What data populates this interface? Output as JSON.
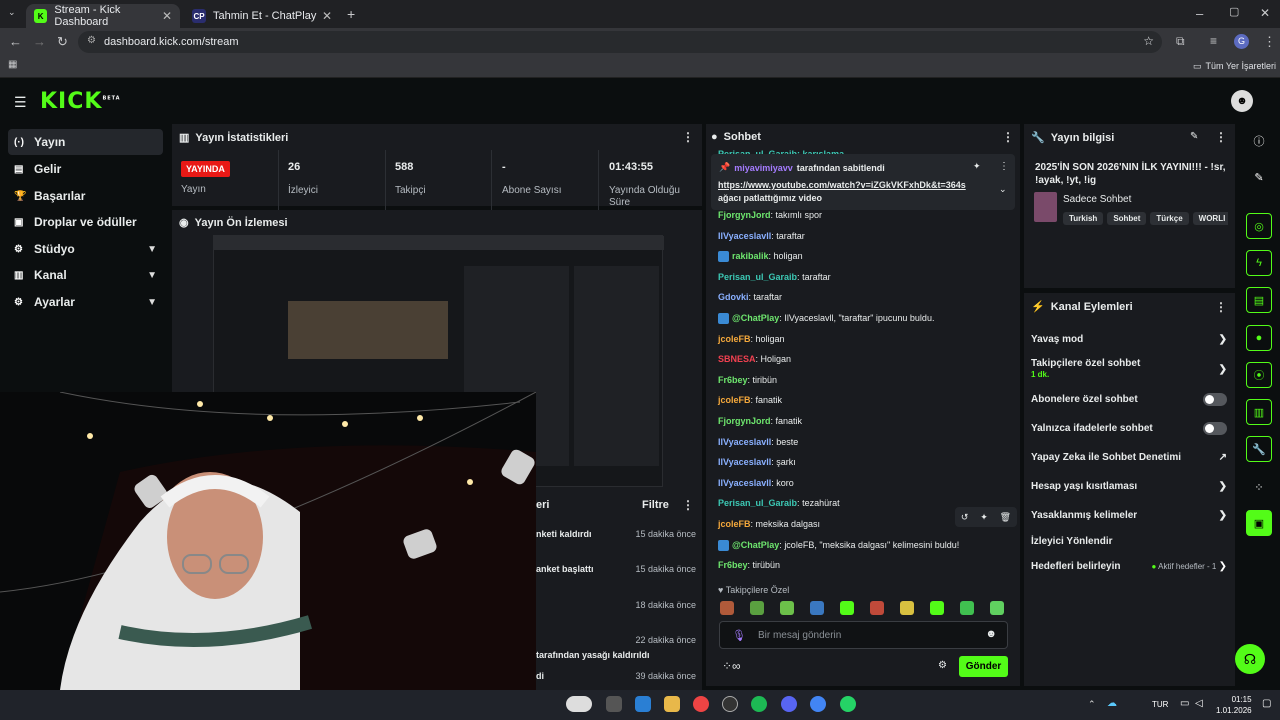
{
  "browser": {
    "tabs": [
      {
        "title": "Stream - Kick Dashboard",
        "icon": "K"
      },
      {
        "title": "Tahmin Et - ChatPlay",
        "icon": "CP"
      }
    ],
    "url": "dashboard.kick.com/stream",
    "bookmarks_label": "Tüm Yer İşaretleri"
  },
  "kick": {
    "logo": "KICK",
    "logo_sup": "BETA",
    "nav": [
      {
        "label": "Yayın",
        "icon": "(·)"
      },
      {
        "label": "Gelir",
        "icon": "▤"
      },
      {
        "label": "Başarılar",
        "icon": "🏆"
      },
      {
        "label": "Droplar ve ödüller",
        "icon": "▣"
      },
      {
        "label": "Stüdyo",
        "icon": "⚙"
      },
      {
        "label": "Kanal",
        "icon": "▥"
      },
      {
        "label": "Ayarlar",
        "icon": "⚙"
      }
    ],
    "stats": {
      "title": "Yayın İstatistikleri",
      "live_badge": "YAYINDA",
      "items": [
        {
          "value": "",
          "label": "Yayın"
        },
        {
          "value": "26",
          "label": "İzleyici"
        },
        {
          "value": "588",
          "label": "Takipçi"
        },
        {
          "value": "-",
          "label": "Abone Sayısı"
        },
        {
          "value": "01:43:55",
          "label": "Yayında Olduğu Süre"
        }
      ]
    },
    "preview": {
      "title": "Yayın Ön İzlemesi"
    },
    "recent": {
      "title_fragment": "eri",
      "filter": "Filtre",
      "rows": [
        {
          "text": "nketi kaldırdı",
          "time": "15 dakika önce"
        },
        {
          "text": "anket başlattı",
          "time": "15 dakika önce"
        },
        {
          "text": "",
          "time": "18 dakika önce"
        },
        {
          "text": "",
          "time": "22 dakika önce"
        },
        {
          "text": "tarafından yasağı kaldırıldı",
          "time": ""
        },
        {
          "text": "di",
          "time": "39 dakika önce"
        }
      ]
    },
    "chat": {
      "title": "Sohbet",
      "top_partial": "Perisan_ul_Garaib: karışlama",
      "pinned_by": "miyavimiyavv",
      "pinned_suffix": "tarafından sabitlendi",
      "pinned_link": "https://www.youtube.com/watch?v=iZGkVKFxhDk&t=364s",
      "pinned_text": "ağacı patlattığımız video",
      "messages": [
        {
          "user": "FjorgynJord",
          "text": "takımlı spor",
          "color": "green",
          "badge": false
        },
        {
          "user": "IlVyaceslavll",
          "text": "taraftar",
          "color": "blue",
          "badge": false
        },
        {
          "user": "rakibalik",
          "text": "holigan",
          "color": "green",
          "badge": true
        },
        {
          "user": "Perisan_ul_Garaib",
          "text": "taraftar",
          "color": "teal",
          "badge": false
        },
        {
          "user": "Gdovki",
          "text": "taraftar",
          "color": "blue",
          "badge": false
        },
        {
          "user": "@ChatPlay",
          "text": "IlVyaceslavll, \"taraftar\" ipucunu buldu.",
          "color": "green",
          "badge": true
        },
        {
          "user": "jcoleFB",
          "text": "holigan",
          "color": "orange",
          "badge": false
        },
        {
          "user": "SBNESA",
          "text": "Holigan",
          "color": "red",
          "badge": false
        },
        {
          "user": "Fr6bey",
          "text": "tiribün",
          "color": "green",
          "badge": false
        },
        {
          "user": "jcoleFB",
          "text": "fanatik",
          "color": "orange",
          "badge": false
        },
        {
          "user": "FjorgynJord",
          "text": "fanatik",
          "color": "green",
          "badge": false
        },
        {
          "user": "IlVyaceslavll",
          "text": "beste",
          "color": "blue",
          "badge": false
        },
        {
          "user": "IlVyaceslavll",
          "text": "şarkı",
          "color": "blue",
          "badge": false
        },
        {
          "user": "IlVyaceslavll",
          "text": "koro",
          "color": "blue",
          "badge": false
        },
        {
          "user": "Perisan_ul_Garaib",
          "text": "tezahürat",
          "color": "teal",
          "badge": false
        },
        {
          "user": "jcoleFB",
          "text": "meksika dalgası",
          "color": "orange",
          "badge": false
        },
        {
          "user": "@ChatPlay",
          "text": "jcoleFB, \"meksika dalgası\" kelimesini buldu!",
          "color": "green",
          "badge": true
        },
        {
          "user": "Fr6bey",
          "text": "tirübün",
          "color": "green",
          "badge": false
        }
      ],
      "followers_only": "Takipçilere Özel",
      "placeholder": "Bir mesaj gönderin",
      "send": "Gönder"
    },
    "stream_info": {
      "title": "Yayın bilgisi",
      "stream_title": "2025'İN SON 2026'NIN İLK YAYINI!!! - !sr, !ayak, !yt, !ig",
      "category": "Sadece Sohbet",
      "tags": [
        "Turkish",
        "Sohbet",
        "Türkçe",
        "WORLI"
      ]
    },
    "actions": {
      "title": "Kanal Eylemleri",
      "rows": [
        {
          "label": "Yavaş mod",
          "control": "chevron"
        },
        {
          "label": "Takipçilere özel sohbet",
          "sub": "1 dk.",
          "control": "chevron"
        },
        {
          "label": "Abonelere özel sohbet",
          "control": "toggle"
        },
        {
          "label": "Yalnızca ifadelerle sohbet",
          "control": "toggle"
        },
        {
          "label": "Yapay Zeka ile Sohbet Denetimi",
          "control": "external"
        },
        {
          "label": "Hesap yaşı kısıtlaması",
          "control": "chevron"
        },
        {
          "label": "Yasaklanmış kelimeler",
          "control": "chevron"
        },
        {
          "label": "İzleyici Yönlendir",
          "control": "none"
        },
        {
          "label": "Hedefleri belirleyin",
          "control": "chevron",
          "extra": "Aktif hedefler - 1"
        }
      ]
    }
  },
  "taskbar": {
    "lang": "TUR",
    "time": "01:15",
    "date": "1.01.2026"
  },
  "colors": {
    "kick_green": "#53fc18",
    "bg": "#0b0e0f",
    "panel": "#191b1f",
    "live": "#e91916"
  }
}
